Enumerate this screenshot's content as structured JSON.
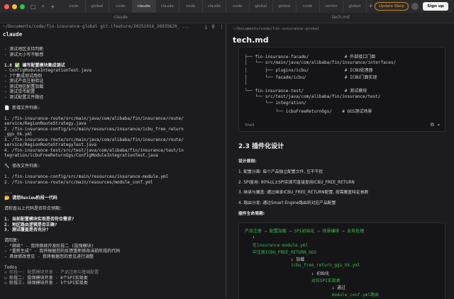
{
  "titlebar": {
    "tabs": [
      "code",
      "global",
      "code",
      "claude",
      "claude",
      "code",
      "claude",
      "code",
      "global",
      "global",
      "code",
      "center",
      "global"
    ],
    "active_tab_index": 3,
    "update_label": "Update Warp",
    "signup_label": "Sign up",
    "colors": {
      "close": "#ff5f57",
      "min": "#febc2e",
      "max": "#28c840",
      "accent": "#e0a040"
    }
  },
  "subbar": {
    "left_title": "claude",
    "right_title": "tech.md"
  },
  "left": {
    "path": "~/Documents/code/fin-insurance-global git:(feature/20251016_26935620_ ...",
    "title": "claude",
    "lines": [
      {
        "t": "- 测试地区支持判断",
        "s": ""
      },
      {
        "t": "- 测试大小写不敏感",
        "s": ""
      },
      {
        "t": "",
        "s": ""
      },
      {
        "t": "1.8 ✅ 编写配置模块集成测试",
        "s": "b"
      },
      {
        "t": "- ConfigModuleIntegrationTest.java",
        "s": ""
      },
      {
        "t": "- 7个集成测试用例",
        "s": ""
      },
      {
        "t": "- 测试产品注册验证",
        "s": ""
      },
      {
        "t": "- 测试地区配置加载",
        "s": ""
      },
      {
        "t": "- 测试货币配置",
        "s": ""
      },
      {
        "t": "- 测试配置文件路径",
        "s": ""
      },
      {
        "t": "",
        "s": ""
      },
      {
        "t": "📄 新增文件列表:",
        "s": ""
      },
      {
        "t": "",
        "s": ""
      },
      {
        "t": "1. /fin-insurance-route/src/main/java/com/alibaba/fin/insurance/route/",
        "s": ""
      },
      {
        "t": "service/RegionRouteStrategy.java",
        "s": ""
      },
      {
        "t": "2. /fin-insurance-config/src/main/resources/insurance/icbu_free_return",
        "s": ""
      },
      {
        "t": "_ggs_hk.yml",
        "s": ""
      },
      {
        "t": "3. /fin-insurance-route/src/main/java/com/alibaba/fin/insurance/route/",
        "s": ""
      },
      {
        "t": "service/RegionRouteStrategyTest.java",
        "s": ""
      },
      {
        "t": "4. /fin-insurance-test/src/test/java/com/alibaba/fin/insurance/test/in",
        "s": ""
      },
      {
        "t": "tegration/icbuFreeReturnGgs/ConfigModuleIntegrationTest.java",
        "s": ""
      },
      {
        "t": "",
        "s": ""
      },
      {
        "t": "🔧 修改文件列表:",
        "s": ""
      },
      {
        "t": "",
        "s": ""
      },
      {
        "t": "1. /fin-insurance-config/src/main/resources/insurance-module.yml",
        "s": ""
      },
      {
        "t": "2. /fin-insurance-route/src/main/resources/module_conf.yml",
        "s": ""
      },
      {
        "t": "",
        "s": ""
      },
      {
        "t": "---",
        "s": ""
      },
      {
        "t": "🤔 请您Review阶段一代码",
        "s": "b"
      },
      {
        "t": "",
        "s": ""
      },
      {
        "t": "请检查以上代码是否符合预期:",
        "s": ""
      },
      {
        "t": "",
        "s": ""
      },
      {
        "t": "1. 当前配置模块实现是否符合需求?",
        "s": "b"
      },
      {
        "t": "2. 地区路由逻辑是否正确?",
        "s": "b"
      },
      {
        "t": "3. 测试覆盖是否充分?",
        "s": "b"
      },
      {
        "t": "",
        "s": ""
      },
      {
        "t": "请回复:",
        "s": ""
      },
      {
        "t": "- \"继续\" - 我将继续开发阶段二 (投保模块)",
        "s": ""
      },
      {
        "t": "- \"重新生成\" - 我将根据您的反馈重新修改当前阶段的代码",
        "s": ""
      },
      {
        "t": "- 具体修改意见 - 我将根据您的意见进行调整",
        "s": ""
      },
      {
        "t": "",
        "s": ""
      },
      {
        "t": "Todos",
        "s": ""
      },
      {
        "t": "☒ 阶段一: 配置模块开发 - 产品注册与基础配置",
        "s": "dim"
      },
      {
        "t": "☐ 阶段二: 投保模块开发 - 6个SPI实现类",
        "s": ""
      },
      {
        "t": "☐ 阶段三: 核保模块开发 - 5个SPI实现类",
        "s": ""
      }
    ]
  },
  "right": {
    "path": "~/Documents/code/fin-insurance-global",
    "title": "tech.md",
    "tree": [
      "├── fin-insurance-facade/              # 外部接口门面",
      "│   └── src/main/java/com/alibaba/fin/insurance/interfaces/",
      "│       ├── plugins/icbu/              # ICBU处理器",
      "│       └── facade/icbu/               # ICBU门面实现",
      "│",
      "└── fin-insurance-test/                # 测试模块",
      "    └── src/test/java/com/alibaba/fin/insurance/test/",
      "        └── integration/",
      "            └── icbuFreeReturnGgs/    # GGS测试场景"
    ],
    "shell_label": "Shell",
    "section_title": "2.3 插件化设计",
    "design_principle_label": "设计原则:",
    "principles": [
      "1. 配置分离: 每个产品独立配置文件, 互不干扰",
      "2. SPI复用: 90%以上SPI实现可直接复用ICBU_FREE_RETURN",
      "3. 继承与覆盖: 通过继承ICBU_FREE_RETURN配置, 按需覆盖特定参数",
      "4. 路由分发: 通过Smart Engine路由到对应产品配置"
    ],
    "lifecycle_label": "插件生命周期:",
    "flow": [
      {
        "t": "产品注册 → 配置加载 → SPI初始化 → 场景编排 → 业务处理",
        "c": "mix"
      },
      {
        "t": "   ↓",
        "c": "w"
      },
      {
        "t": "   在insurance-module.yml",
        "c": "g"
      },
      {
        "t": "   中注册ICBU_FREE_RETURN_GGS",
        "c": "g"
      },
      {
        "t": "                  ↓ 加载",
        "c": "w"
      },
      {
        "t": "                  icbu_free_return_ggs_hk.yml",
        "c": "g"
      },
      {
        "t": "                          ↓ 初始化",
        "c": "w"
      },
      {
        "t": "                          对应SPI实现类",
        "c": "g"
      },
      {
        "t": "                                  ↓ 通过",
        "c": "w"
      },
      {
        "t": "                                  module_conf.yml路由",
        "c": "g"
      }
    ]
  }
}
